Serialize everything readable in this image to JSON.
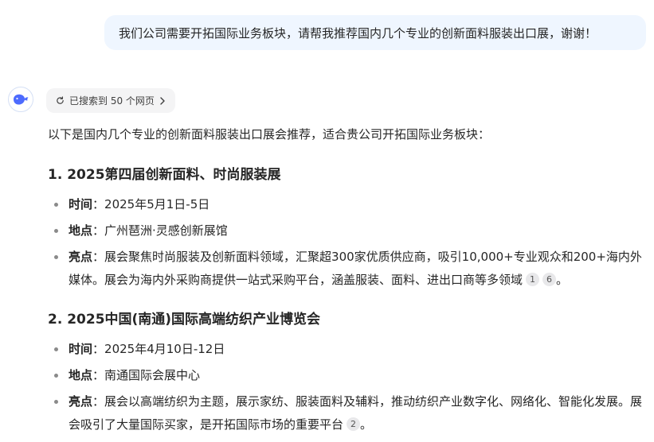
{
  "user_message": "我们公司需要开拓国际业务板块，请帮我推荐国内几个专业的创新面料服装出口展，谢谢！",
  "search_chip": {
    "label": "已搜索到 50 个网页",
    "chevron": "chevron-right-icon"
  },
  "intro": "以下是国内几个专业的创新面料服装出口展会推荐，适合贵公司开拓国际业务板块：",
  "colors": {
    "user_bubble": "#eff6ff",
    "avatar_accent": "#4d6bfe",
    "citation_bg": "#e8e8ea"
  },
  "sections": [
    {
      "title": "1. 2025第四届创新面料、时尚服装展",
      "items": [
        {
          "label": "时间",
          "sep": "：",
          "text": "2025年5月1日-5日",
          "cites": []
        },
        {
          "label": "地点",
          "sep": "：",
          "text": "广州琶洲·灵感创新展馆",
          "cites": []
        },
        {
          "label": "亮点",
          "sep": "：",
          "text": "展会聚焦时尚服装及创新面料领域，汇聚超300家优质供应商，吸引10,000+专业观众和200+海内外媒体。展会为海内外采购商提供一站式采购平台，涵盖服装、面料、进出口商等多领域",
          "cites": [
            "1",
            "6"
          ],
          "end": "。"
        }
      ]
    },
    {
      "title": "2. 2025中国(南通)国际高端纺织产业博览会",
      "items": [
        {
          "label": "时间",
          "sep": "：",
          "text": "2025年4月10日-12日",
          "cites": []
        },
        {
          "label": "地点",
          "sep": "：",
          "text": "南通国际会展中心",
          "cites": []
        },
        {
          "label": "亮点",
          "sep": "：",
          "text": "展会以高端纺织为主题，展示家纺、服装面料及辅料，推动纺织产业数字化、网络化、智能化发展。展会吸引了大量国际买家，是开拓国际市场的重要平台",
          "cites": [
            "2"
          ],
          "end": "。"
        }
      ]
    }
  ]
}
